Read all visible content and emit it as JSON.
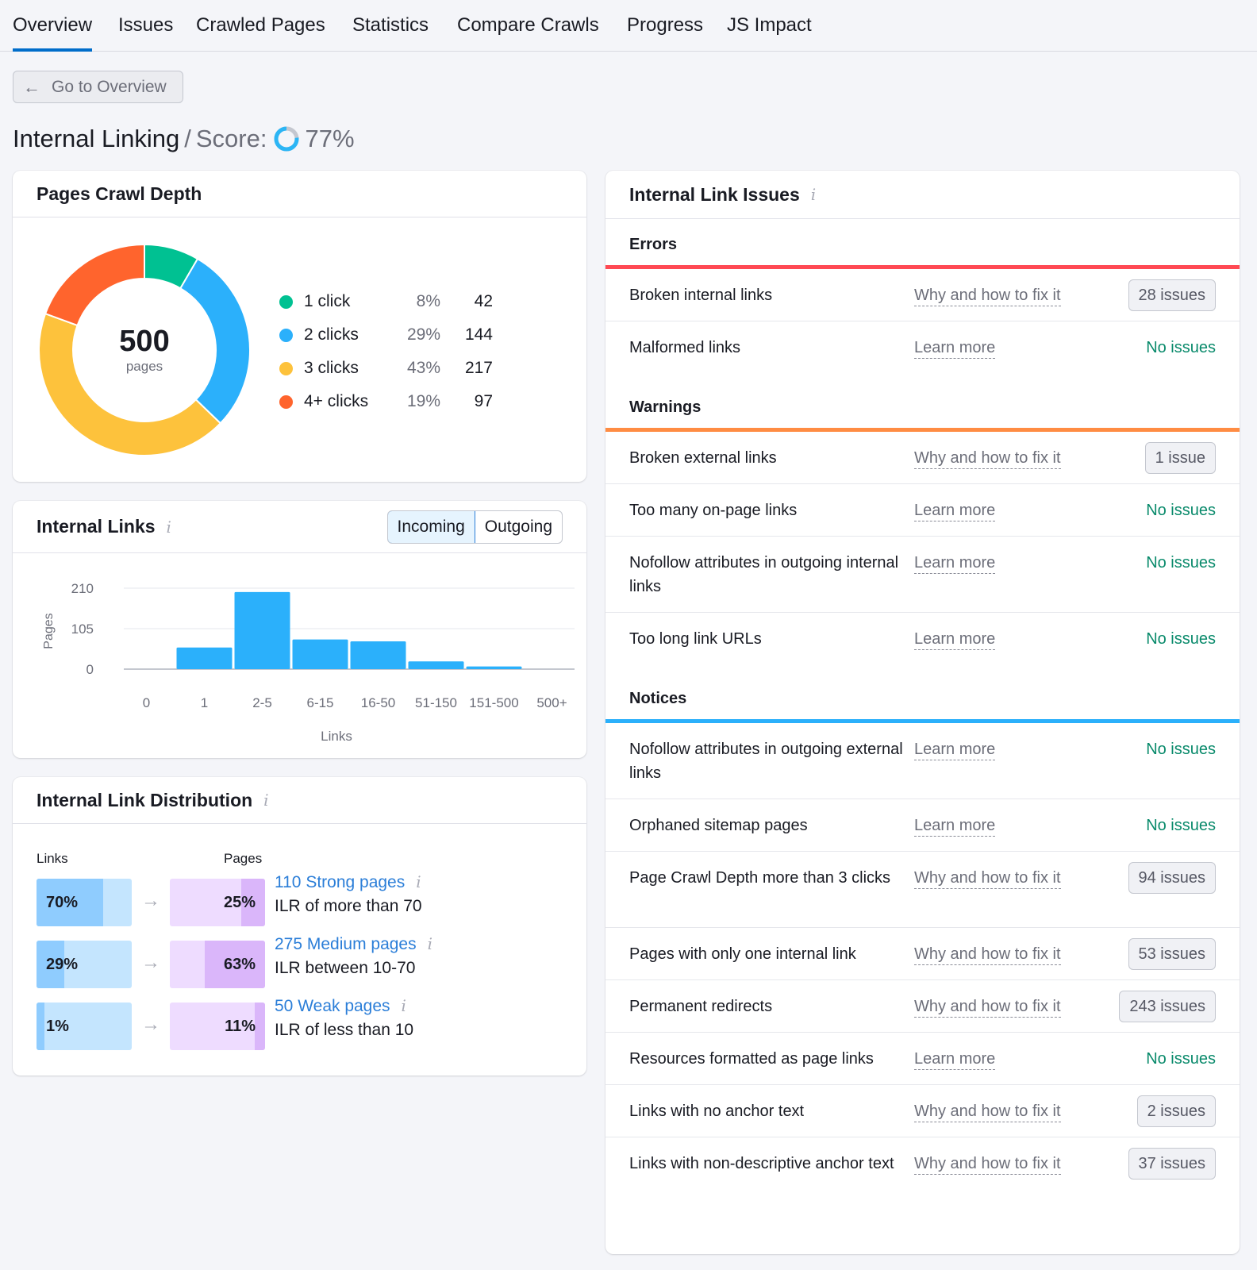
{
  "tabs": [
    {
      "label": "Overview",
      "active": true
    },
    {
      "label": "Issues"
    },
    {
      "label": "Crawled Pages"
    },
    {
      "label": "Statistics"
    },
    {
      "label": "Compare Crawls"
    },
    {
      "label": "Progress"
    },
    {
      "label": "JS Impact"
    }
  ],
  "back_button": {
    "label": "Go to Overview",
    "icon": "arrow-left-icon"
  },
  "header": {
    "title": "Internal Linking",
    "separator": "/",
    "score_label": "Score:",
    "score_value": "77%",
    "score_fraction": 0.77,
    "score_color": "#2BB5F5",
    "score_track_color": "#C4C7CF"
  },
  "crawl_depth": {
    "title": "Pages Crawl Depth",
    "total": "500",
    "total_label": "pages",
    "items": [
      {
        "label": "1 click",
        "pct": "8%",
        "count": "42",
        "value": 42,
        "color": "#00C192"
      },
      {
        "label": "2 clicks",
        "pct": "29%",
        "count": "144",
        "value": 144,
        "color": "#2BB0FB"
      },
      {
        "label": "3 clicks",
        "pct": "43%",
        "count": "217",
        "value": 217,
        "color": "#FDC23C"
      },
      {
        "label": "4+ clicks",
        "pct": "19%",
        "count": "97",
        "value": 97,
        "color": "#FF642D"
      }
    ]
  },
  "internal_links": {
    "title": "Internal Links",
    "toggle": [
      {
        "label": "Incoming",
        "active": true
      },
      {
        "label": "Outgoing"
      }
    ]
  },
  "chart_data": {
    "type": "bar",
    "title": "Internal Links",
    "xlabel": "Links",
    "ylabel": "Pages",
    "categories": [
      "0",
      "1",
      "2-5",
      "6-15",
      "16-50",
      "51-150",
      "151-500",
      "500+"
    ],
    "values": [
      0,
      56,
      200,
      77,
      72,
      20,
      7,
      0
    ],
    "yticks": [
      0,
      105,
      210
    ],
    "ylim": [
      0,
      210
    ],
    "grid": true,
    "bar_color": "#2BB0FB"
  },
  "distribution": {
    "title": "Internal Link Distribution",
    "col_links": "Links",
    "col_pages": "Pages",
    "rows": [
      {
        "links_pct": "70%",
        "links_value": 0.7,
        "pages_pct": "25%",
        "pages_value": 0.25,
        "link": "110 Strong pages",
        "desc": "ILR of more than 70"
      },
      {
        "links_pct": "29%",
        "links_value": 0.29,
        "pages_pct": "63%",
        "pages_value": 0.63,
        "link": "275 Medium pages",
        "desc": "ILR between 10-70"
      },
      {
        "links_pct": "1%",
        "links_value": 0.01,
        "pages_pct": "11%",
        "pages_value": 0.11,
        "link": "50 Weak pages",
        "desc": "ILR of less than 10"
      }
    ]
  },
  "issues": {
    "title": "Internal Link Issues",
    "sections": [
      {
        "name": "Errors",
        "color": "#FF4953",
        "rows": [
          {
            "name": "Broken internal links",
            "link": "Why and how to fix it",
            "status": "28 issues",
            "has_issues": true
          },
          {
            "name": "Malformed links",
            "link": "Learn more",
            "status": "No issues",
            "has_issues": false
          }
        ]
      },
      {
        "name": "Warnings",
        "color": "#FF8C43",
        "rows": [
          {
            "name": "Broken external links",
            "link": "Why and how to fix it",
            "status": "1 issue",
            "has_issues": true
          },
          {
            "name": "Too many on-page links",
            "link": "Learn more",
            "status": "No issues",
            "has_issues": false
          },
          {
            "name": "Nofollow attributes in outgoing internal links",
            "link": "Learn more",
            "status": "No issues",
            "has_issues": false
          },
          {
            "name": "Too long link URLs",
            "link": "Learn more",
            "status": "No issues",
            "has_issues": false
          }
        ]
      },
      {
        "name": "Notices",
        "color": "#2BB0FB",
        "rows": [
          {
            "name": "Nofollow attributes in outgoing external links",
            "link": "Learn more",
            "status": "No issues",
            "has_issues": false
          },
          {
            "name": "Orphaned sitemap pages",
            "link": "Learn more",
            "status": "No issues",
            "has_issues": false
          },
          {
            "name": "Page Crawl Depth more than 3 clicks",
            "link": "Why and how to fix it",
            "status": "94 issues",
            "has_issues": true
          },
          {
            "name": "Pages with only one internal link",
            "link": "Why and how to fix it",
            "status": "53 issues",
            "has_issues": true
          },
          {
            "name": "Permanent redirects",
            "link": "Why and how to fix it",
            "status": "243 issues",
            "has_issues": true
          },
          {
            "name": "Resources formatted as page links",
            "link": "Learn more",
            "status": "No issues",
            "has_issues": false
          },
          {
            "name": "Links with no anchor text",
            "link": "Why and how to fix it",
            "status": "2 issues",
            "has_issues": true
          },
          {
            "name": "Links with non-descriptive anchor text",
            "link": "Why and how to fix it",
            "status": "37 issues",
            "has_issues": true
          }
        ]
      }
    ]
  }
}
